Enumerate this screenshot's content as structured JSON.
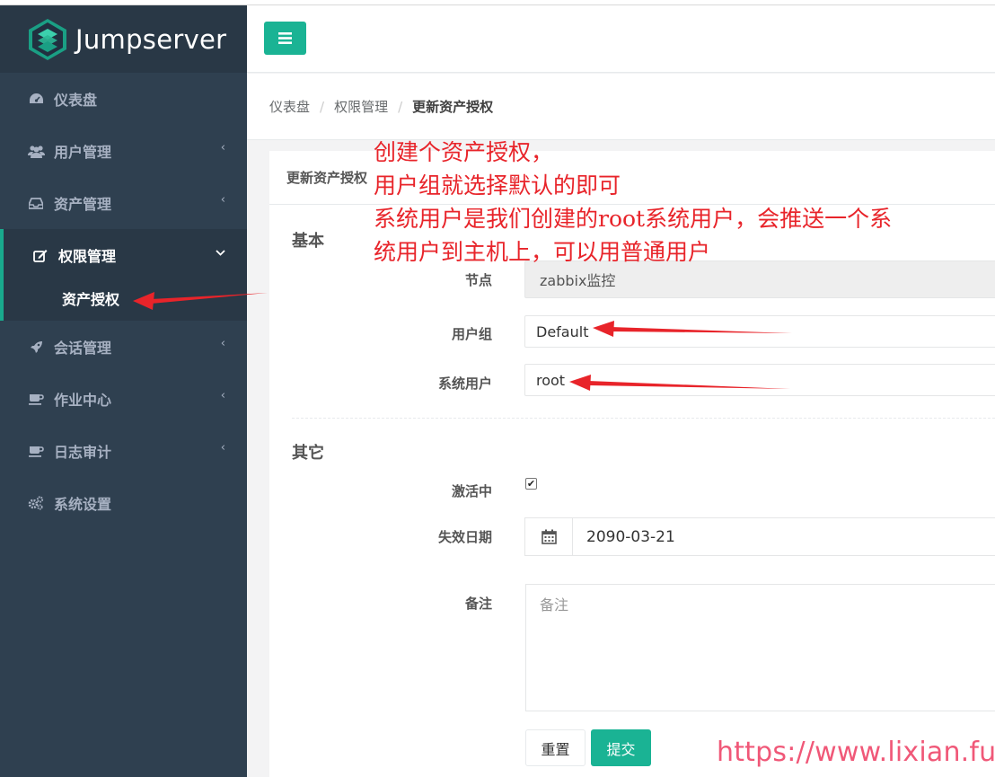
{
  "app": {
    "logo_text": "Jumpserver"
  },
  "sidebar": {
    "items": [
      {
        "label": "仪表盘",
        "icon": "dashboard-icon",
        "has_chevron": false
      },
      {
        "label": "用户管理",
        "icon": "users-icon",
        "has_chevron": true
      },
      {
        "label": "资产管理",
        "icon": "inbox-icon",
        "has_chevron": true
      },
      {
        "label": "权限管理",
        "icon": "edit-icon",
        "has_chevron": true,
        "active": true
      },
      {
        "label": "会话管理",
        "icon": "rocket-icon",
        "has_chevron": true
      },
      {
        "label": "作业中心",
        "icon": "coffee-icon",
        "has_chevron": true
      },
      {
        "label": "日志审计",
        "icon": "coffee-icon",
        "has_chevron": true
      },
      {
        "label": "系统设置",
        "icon": "cogs-icon",
        "has_chevron": false
      }
    ],
    "subitems": [
      {
        "label": "资产授权"
      }
    ],
    "chevron_left": "‹",
    "chevron_down": "⌄"
  },
  "breadcrumb": {
    "items": [
      "仪表盘",
      "权限管理"
    ],
    "current": "更新资产授权",
    "separator": "/"
  },
  "card": {
    "title": "更新资产授权",
    "section_basic": "基本",
    "section_other": "其它",
    "fields": {
      "node_label": "节点",
      "node_value": "zabbix监控",
      "user_group_label": "用户组",
      "user_group_value": "Default",
      "system_user_label": "系统用户",
      "system_user_value": "root",
      "active_label": "激活中",
      "active_checked": true,
      "expire_label": "失效日期",
      "expire_value": "2090-03-21",
      "comment_label": "备注",
      "comment_placeholder": "备注"
    },
    "buttons": {
      "reset": "重置",
      "submit": "提交"
    }
  },
  "annotation": {
    "lines": [
      "创建个资产授权，",
      "用户组就选择默认的即可",
      "系统用户是我们创建的root系统用户，会推送一个系",
      "统用户到主机上，可以用普通用户"
    ]
  },
  "watermark": "https://www.lixian.fun",
  "colors": {
    "sidebar_bg": "#2f4050",
    "sidebar_dark": "#293846",
    "accent": "#1ab394",
    "annotation_red": "#e8242a",
    "watermark_pink": "#f05878"
  }
}
